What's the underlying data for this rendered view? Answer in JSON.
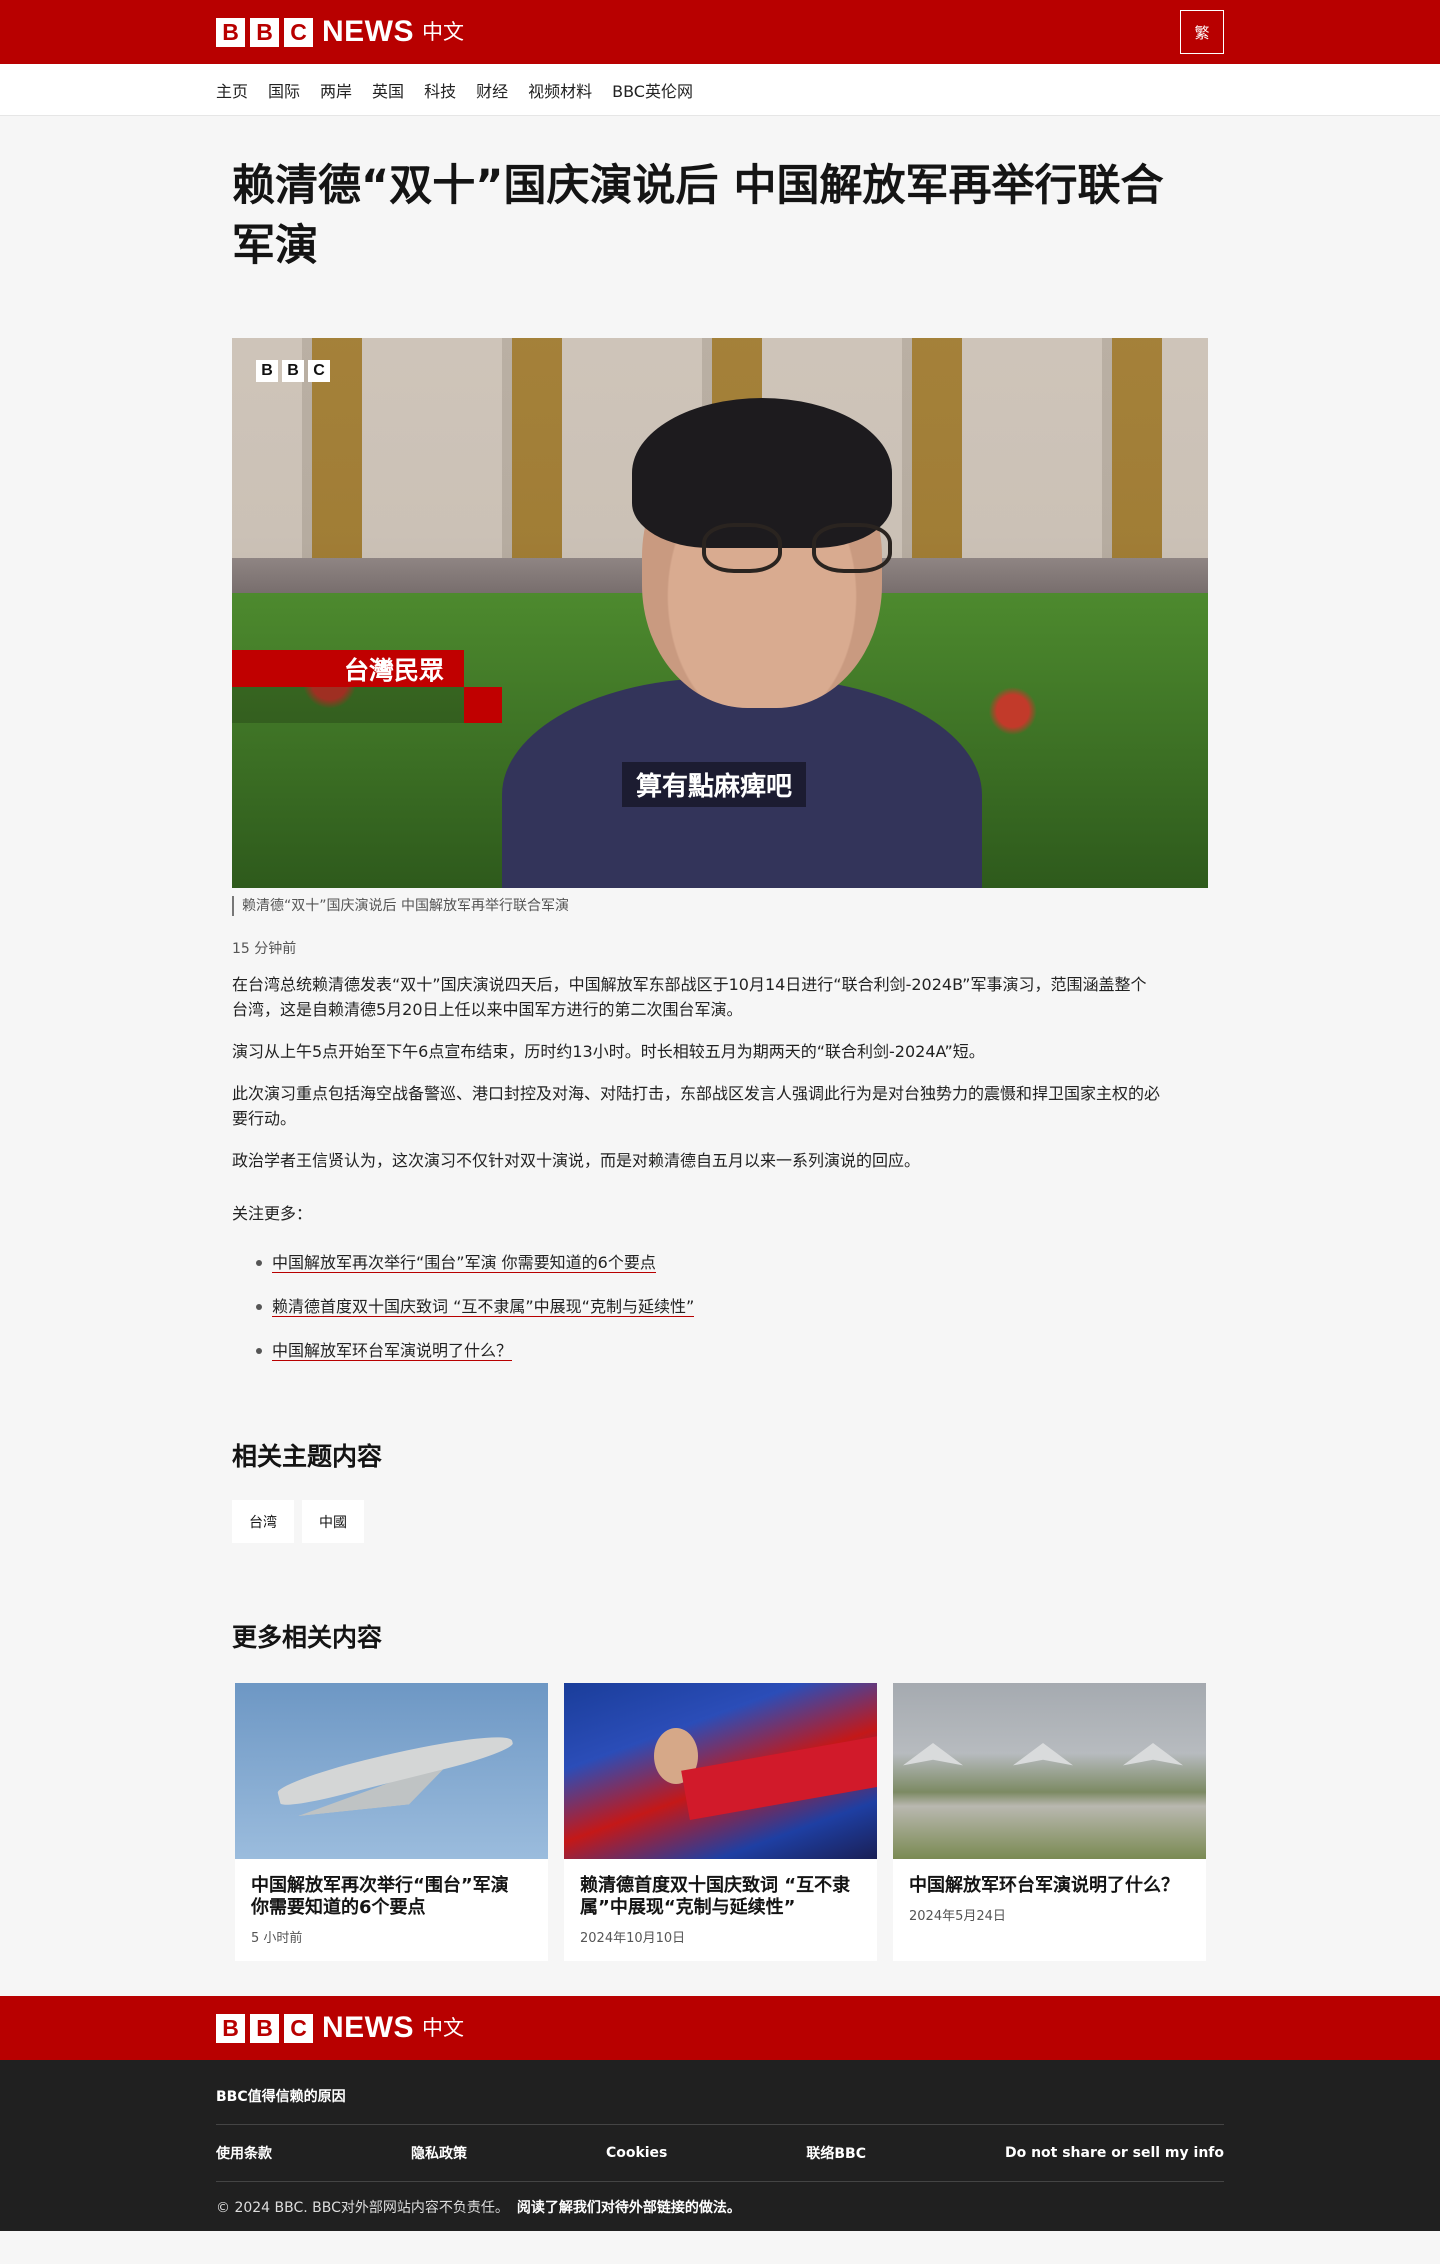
{
  "header": {
    "logo_letters": [
      "B",
      "B",
      "C"
    ],
    "logo_news": "NEWS",
    "logo_lang": "中文",
    "lang_switch": "繁",
    "brand_color": "#b80000"
  },
  "nav": {
    "items": [
      "主页",
      "国际",
      "两岸",
      "英国",
      "科技",
      "财经",
      "视频材料",
      "BBC英伦网"
    ]
  },
  "article": {
    "headline": "赖清德“双十”国庆演说后 中国解放军再举行联合军演",
    "hero": {
      "logo_letters": [
        "B",
        "B",
        "C"
      ],
      "tag": "台灣民眾",
      "subtitle": "算有點麻痺吧"
    },
    "caption": "赖清德“双十”国庆演说后 中国解放军再举行联合军演",
    "timestamp": "15 分钟前",
    "paragraphs": [
      "在台湾总统赖清德发表“双十”国庆演说四天后，中国解放军东部战区于10月14日进行“联合利剑-2024B”军事演习，范围涵盖整个台湾，这是自赖清德5月20日上任以来中国军方进行的第二次围台军演。",
      "演习从上午5点开始至下午6点宣布结束，历时约13小时。时长相较五月为期两天的“联合利剑-2024A”短。",
      "此次演习重点包括海空战备警巡、港口封控及对海、对陆打击，东部战区发言人强调此行为是对台独势力的震慑和捍卫国家主权的必要行动。",
      "政治学者王信贤认为，这次演习不仅针对双十演说，而是对赖清德自五月以来一系列演说的回应。"
    ],
    "see_more": "关注更多：",
    "links": [
      "中国解放军再次举行“围台”军演 你需要知道的6个要点",
      "赖清德首度双十国庆致词 “互不隶属”中展现“克制与延续性”",
      "中国解放军环台军演说明了什么？"
    ]
  },
  "related_topics": {
    "title": "相关主题内容",
    "tags": [
      "台湾",
      "中國"
    ]
  },
  "more_related": {
    "title": "更多相关内容",
    "cards": [
      {
        "title": "中国解放军再次举行“围台”军演 你需要知道的6个要点",
        "date": "5 小时前",
        "image": "fighter-jet"
      },
      {
        "title": "赖清德首度双十国庆致词 “互不隶属”中展现“克制与延续性”",
        "date": "2024年10月10日",
        "image": "rally-crowd"
      },
      {
        "title": "中国解放军环台军演说明了什么？",
        "date": "2024年5月24日",
        "image": "airfield-jets"
      }
    ]
  },
  "footer": {
    "logo_letters": [
      "B",
      "B",
      "C"
    ],
    "logo_news": "NEWS",
    "logo_lang": "中文",
    "trust": "BBC值得信赖的原因",
    "links": [
      "使用条款",
      "隐私政策",
      "Cookies",
      "联络BBC",
      "Do not share or sell my info"
    ],
    "copyright": "© 2024 BBC. BBC对外部网站内容不负责任。",
    "external_link": "阅读了解我们对待外部链接的做法。"
  }
}
